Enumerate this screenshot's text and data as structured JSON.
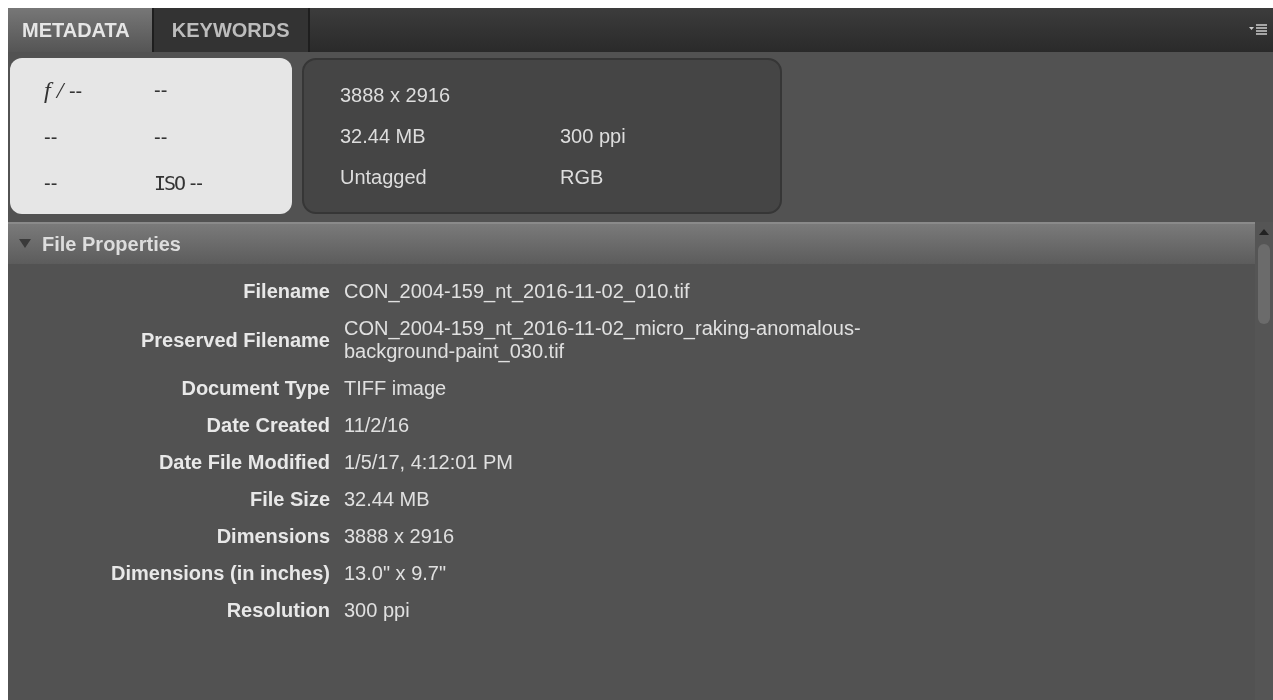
{
  "tabs": [
    {
      "label": "METADATA",
      "selected": true
    },
    {
      "label": "KEYWORDS",
      "selected": false
    }
  ],
  "camera_data": {
    "aperture_prefix": "f /",
    "cells": [
      "--",
      "--",
      "--",
      "--",
      "--"
    ],
    "iso_prefix": "ISO",
    "iso_value": "--"
  },
  "file_info": {
    "dimensions": "3888 x 2916",
    "size": "32.44 MB",
    "resolution": "300 ppi",
    "color_profile": "Untagged",
    "color_mode": "RGB"
  },
  "section": {
    "title": "File Properties",
    "expanded": true,
    "rows": [
      {
        "label": "Filename",
        "value": "CON_2004-159_nt_2016-11-02_010.tif"
      },
      {
        "label": "Preserved Filename",
        "value": "CON_2004-159_nt_2016-11-02_micro_raking-anomalous-background-paint_030.tif"
      },
      {
        "label": "Document Type",
        "value": "TIFF image"
      },
      {
        "label": "Date Created",
        "value": "11/2/16"
      },
      {
        "label": "Date File Modified",
        "value": "1/5/17, 4:12:01 PM"
      },
      {
        "label": "File Size",
        "value": "32.44 MB"
      },
      {
        "label": "Dimensions",
        "value": "3888 x 2916"
      },
      {
        "label": "Dimensions (in inches)",
        "value": "13.0\" x 9.7\""
      },
      {
        "label": "Resolution",
        "value": "300 ppi"
      }
    ]
  }
}
